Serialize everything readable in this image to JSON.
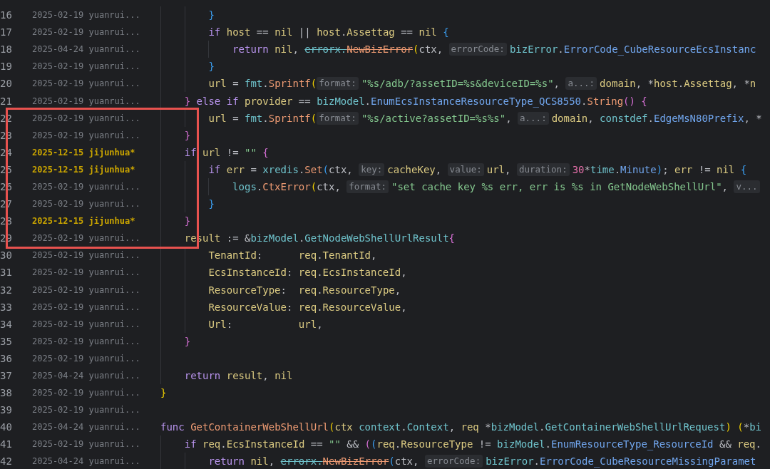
{
  "editor": {
    "lines": [
      {
        "kind": "block",
        "children": [
          {
            "kind": "block",
            "children": [
              {
                "kind": "line",
                "number": "16",
                "blame": {
                  "date": "2025-02-19",
                  "author": "yuanrui...",
                  "highlighted": false
                },
                "code": [
                  {
                    "kind": "bracket_3",
                    "text": "}"
                  }
                ]
              },
              {
                "kind": "line",
                "number": "17",
                "blame": {
                  "date": "2025-02-19",
                  "author": "yuanrui...",
                  "highlighted": false
                },
                "code": [
                  {
                    "kind": "keyword",
                    "text": "if "
                  },
                  {
                    "kind": "var",
                    "text": "host"
                  },
                  {
                    "kind": "plain",
                    "text": " == "
                  },
                  {
                    "kind": "var",
                    "text": "nil"
                  },
                  {
                    "kind": "plain",
                    "text": " || "
                  },
                  {
                    "kind": "var",
                    "text": "host"
                  },
                  {
                    "kind": "plain",
                    "text": "."
                  },
                  {
                    "kind": "field",
                    "text": "Assettag"
                  },
                  {
                    "kind": "plain",
                    "text": " == "
                  },
                  {
                    "kind": "var",
                    "text": "nil "
                  },
                  {
                    "kind": "bracket_3",
                    "text": "{"
                  }
                ]
              },
              {
                "kind": "block",
                "children": [
                  {
                    "kind": "line",
                    "number": "18",
                    "blame": {
                      "date": "2025-04-24",
                      "author": "yuanrui...",
                      "highlighted": false
                    },
                    "code": [
                      {
                        "kind": "keyword",
                        "text": "return "
                      },
                      {
                        "kind": "var",
                        "text": "nil"
                      },
                      {
                        "kind": "plain",
                        "text": ", "
                      },
                      {
                        "kind": "deprecated_pkg",
                        "text": "errorx."
                      },
                      {
                        "kind": "deprecated_func",
                        "text": "NewBizError"
                      },
                      {
                        "kind": "bracket_1",
                        "text": "("
                      },
                      {
                        "kind": "plain",
                        "text": "ctx, "
                      },
                      {
                        "kind": "hint",
                        "text": "errorCode:"
                      },
                      {
                        "kind": "pkg",
                        "text": "bizError"
                      },
                      {
                        "kind": "plain",
                        "text": "."
                      },
                      {
                        "kind": "const",
                        "text": "ErrorCode_CubeResourceEcsInstanc"
                      }
                    ]
                  }
                ]
              },
              {
                "kind": "line",
                "number": "19",
                "blame": {
                  "date": "2025-02-19",
                  "author": "yuanrui...",
                  "highlighted": false
                },
                "code": [
                  {
                    "kind": "bracket_3",
                    "text": "}"
                  }
                ]
              },
              {
                "kind": "line",
                "number": "20",
                "blame": {
                  "date": "2025-02-19",
                  "author": "yuanrui...",
                  "highlighted": false
                },
                "code": [
                  {
                    "kind": "var",
                    "text": "url"
                  },
                  {
                    "kind": "plain",
                    "text": " = "
                  },
                  {
                    "kind": "pkg",
                    "text": "fmt"
                  },
                  {
                    "kind": "plain",
                    "text": "."
                  },
                  {
                    "kind": "func",
                    "text": "Sprintf"
                  },
                  {
                    "kind": "bracket_1",
                    "text": "("
                  },
                  {
                    "kind": "hint",
                    "text": "format:"
                  },
                  {
                    "kind": "str",
                    "text": "\"%s/adb/?assetID=%s&deviceID=%s\""
                  },
                  {
                    "kind": "plain",
                    "text": ", "
                  },
                  {
                    "kind": "hint",
                    "text": "a...:"
                  },
                  {
                    "kind": "var",
                    "text": "domain"
                  },
                  {
                    "kind": "plain",
                    "text": ", *"
                  },
                  {
                    "kind": "var",
                    "text": "host"
                  },
                  {
                    "kind": "plain",
                    "text": "."
                  },
                  {
                    "kind": "field",
                    "text": "Assettag"
                  },
                  {
                    "kind": "plain",
                    "text": ", *"
                  },
                  {
                    "kind": "var",
                    "text": "n"
                  }
                ]
              }
            ]
          },
          {
            "kind": "line",
            "number": "21",
            "blame": {
              "date": "2025-02-19",
              "author": "yuanrui...",
              "highlighted": false
            },
            "code": [
              {
                "kind": "bracket_2",
                "text": "} "
              },
              {
                "kind": "keyword",
                "text": "else if "
              },
              {
                "kind": "var",
                "text": "provider"
              },
              {
                "kind": "plain",
                "text": " == "
              },
              {
                "kind": "pkg",
                "text": "bizModel"
              },
              {
                "kind": "plain",
                "text": "."
              },
              {
                "kind": "const",
                "text": "EnumEcsInstanceResourceType_QCS8550"
              },
              {
                "kind": "plain",
                "text": "."
              },
              {
                "kind": "func",
                "text": "String"
              },
              {
                "kind": "bracket_2",
                "text": "() {"
              }
            ]
          },
          {
            "kind": "block",
            "children": [
              {
                "kind": "line",
                "number": "22",
                "blame": {
                  "date": "2025-02-19",
                  "author": "yuanrui...",
                  "highlighted": false
                },
                "code": [
                  {
                    "kind": "var",
                    "text": "url"
                  },
                  {
                    "kind": "plain",
                    "text": " = "
                  },
                  {
                    "kind": "pkg",
                    "text": "fmt"
                  },
                  {
                    "kind": "plain",
                    "text": "."
                  },
                  {
                    "kind": "func",
                    "text": "Sprintf"
                  },
                  {
                    "kind": "bracket_1",
                    "text": "("
                  },
                  {
                    "kind": "hint",
                    "text": "format:"
                  },
                  {
                    "kind": "str",
                    "text": "\"%s/active?assetID=%s%s\""
                  },
                  {
                    "kind": "plain",
                    "text": ", "
                  },
                  {
                    "kind": "hint",
                    "text": "a...:"
                  },
                  {
                    "kind": "var",
                    "text": "domain"
                  },
                  {
                    "kind": "plain",
                    "text": ", "
                  },
                  {
                    "kind": "pkg",
                    "text": "constdef"
                  },
                  {
                    "kind": "plain",
                    "text": "."
                  },
                  {
                    "kind": "const",
                    "text": "EdgeMsN80Prefix"
                  },
                  {
                    "kind": "plain",
                    "text": ", *"
                  }
                ]
              }
            ]
          },
          {
            "kind": "line",
            "number": "23",
            "blame": {
              "date": "2025-02-19",
              "author": "yuanrui...",
              "highlighted": false
            },
            "code": [
              {
                "kind": "bracket_2",
                "text": "}"
              }
            ]
          },
          {
            "kind": "line",
            "number": "24",
            "blame": {
              "date": "2025-12-15",
              "author": "jijunhua*",
              "highlighted": true
            },
            "code": [
              {
                "kind": "keyword",
                "text": "if "
              },
              {
                "kind": "var",
                "text": "url"
              },
              {
                "kind": "plain",
                "text": " != "
              },
              {
                "kind": "str",
                "text": "\"\" "
              },
              {
                "kind": "bracket_2",
                "text": "{"
              }
            ]
          },
          {
            "kind": "block",
            "children": [
              {
                "kind": "line",
                "number": "25",
                "blame": {
                  "date": "2025-12-15",
                  "author": "jijunhua*",
                  "highlighted": true
                },
                "code": [
                  {
                    "kind": "keyword",
                    "text": "if "
                  },
                  {
                    "kind": "var",
                    "text": "err"
                  },
                  {
                    "kind": "plain",
                    "text": " = "
                  },
                  {
                    "kind": "pkg",
                    "text": "xredis"
                  },
                  {
                    "kind": "plain",
                    "text": "."
                  },
                  {
                    "kind": "func",
                    "text": "Set"
                  },
                  {
                    "kind": "bracket_3",
                    "text": "("
                  },
                  {
                    "kind": "plain",
                    "text": "ctx, "
                  },
                  {
                    "kind": "hint",
                    "text": "key:"
                  },
                  {
                    "kind": "var",
                    "text": "cacheKey"
                  },
                  {
                    "kind": "plain",
                    "text": ", "
                  },
                  {
                    "kind": "hint",
                    "text": "value:"
                  },
                  {
                    "kind": "var",
                    "text": "url"
                  },
                  {
                    "kind": "plain",
                    "text": ", "
                  },
                  {
                    "kind": "hint",
                    "text": "duration:"
                  },
                  {
                    "kind": "num",
                    "text": "30"
                  },
                  {
                    "kind": "plain",
                    "text": "*"
                  },
                  {
                    "kind": "pkg",
                    "text": "time"
                  },
                  {
                    "kind": "plain",
                    "text": "."
                  },
                  {
                    "kind": "const",
                    "text": "Minute"
                  },
                  {
                    "kind": "bracket_3",
                    "text": ")"
                  },
                  {
                    "kind": "plain",
                    "text": "; "
                  },
                  {
                    "kind": "var",
                    "text": "err"
                  },
                  {
                    "kind": "plain",
                    "text": " != "
                  },
                  {
                    "kind": "var",
                    "text": "nil "
                  },
                  {
                    "kind": "bracket_3",
                    "text": "{"
                  }
                ]
              },
              {
                "kind": "block",
                "children": [
                  {
                    "kind": "line",
                    "number": "26",
                    "blame": {
                      "date": "2025-02-19",
                      "author": "yuanrui...",
                      "highlighted": false
                    },
                    "code": [
                      {
                        "kind": "pkg",
                        "text": "logs"
                      },
                      {
                        "kind": "plain",
                        "text": "."
                      },
                      {
                        "kind": "func",
                        "text": "CtxError"
                      },
                      {
                        "kind": "bracket_1",
                        "text": "("
                      },
                      {
                        "kind": "plain",
                        "text": "ctx, "
                      },
                      {
                        "kind": "hint",
                        "text": "format:"
                      },
                      {
                        "kind": "str",
                        "text": "\"set cache key %s err, err is %s in GetNodeWebShellUrl\""
                      },
                      {
                        "kind": "plain",
                        "text": ", "
                      },
                      {
                        "kind": "hint",
                        "text": "v..."
                      }
                    ]
                  }
                ]
              },
              {
                "kind": "line",
                "number": "27",
                "blame": {
                  "date": "2025-02-19",
                  "author": "yuanrui...",
                  "highlighted": false
                },
                "code": [
                  {
                    "kind": "bracket_3",
                    "text": "}"
                  }
                ]
              }
            ]
          },
          {
            "kind": "line",
            "number": "28",
            "blame": {
              "date": "2025-12-15",
              "author": "jijunhua*",
              "highlighted": true
            },
            "code": [
              {
                "kind": "bracket_2",
                "text": "}"
              }
            ]
          },
          {
            "kind": "line",
            "number": "29",
            "blame": {
              "date": "2025-02-19",
              "author": "yuanrui...",
              "highlighted": false
            },
            "code": [
              {
                "kind": "var",
                "text": "result"
              },
              {
                "kind": "plain",
                "text": " := &"
              },
              {
                "kind": "pkg",
                "text": "bizModel"
              },
              {
                "kind": "plain",
                "text": "."
              },
              {
                "kind": "type",
                "text": "GetNodeWebShellUrlResult"
              },
              {
                "kind": "bracket_2",
                "text": "{"
              }
            ]
          },
          {
            "kind": "block",
            "children": [
              {
                "kind": "line",
                "number": "30",
                "blame": {
                  "date": "2025-02-19",
                  "author": "yuanrui...",
                  "highlighted": false
                },
                "code": [
                  {
                    "kind": "field",
                    "text": "TenantId"
                  },
                  {
                    "kind": "plain",
                    "text": ":      "
                  },
                  {
                    "kind": "var",
                    "text": "req"
                  },
                  {
                    "kind": "plain",
                    "text": "."
                  },
                  {
                    "kind": "field",
                    "text": "TenantId"
                  },
                  {
                    "kind": "plain",
                    "text": ","
                  }
                ]
              },
              {
                "kind": "line",
                "number": "31",
                "blame": {
                  "date": "2025-02-19",
                  "author": "yuanrui...",
                  "highlighted": false
                },
                "code": [
                  {
                    "kind": "field",
                    "text": "EcsInstanceId"
                  },
                  {
                    "kind": "plain",
                    "text": ": "
                  },
                  {
                    "kind": "var",
                    "text": "req"
                  },
                  {
                    "kind": "plain",
                    "text": "."
                  },
                  {
                    "kind": "field",
                    "text": "EcsInstanceId"
                  },
                  {
                    "kind": "plain",
                    "text": ","
                  }
                ]
              },
              {
                "kind": "line",
                "number": "32",
                "blame": {
                  "date": "2025-02-19",
                  "author": "yuanrui...",
                  "highlighted": false
                },
                "code": [
                  {
                    "kind": "field",
                    "text": "ResourceType"
                  },
                  {
                    "kind": "plain",
                    "text": ":  "
                  },
                  {
                    "kind": "var",
                    "text": "req"
                  },
                  {
                    "kind": "plain",
                    "text": "."
                  },
                  {
                    "kind": "field",
                    "text": "ResourceType"
                  },
                  {
                    "kind": "plain",
                    "text": ","
                  }
                ]
              },
              {
                "kind": "line",
                "number": "33",
                "blame": {
                  "date": "2025-02-19",
                  "author": "yuanrui...",
                  "highlighted": false
                },
                "code": [
                  {
                    "kind": "field",
                    "text": "ResourceValue"
                  },
                  {
                    "kind": "plain",
                    "text": ": "
                  },
                  {
                    "kind": "var",
                    "text": "req"
                  },
                  {
                    "kind": "plain",
                    "text": "."
                  },
                  {
                    "kind": "field",
                    "text": "ResourceValue"
                  },
                  {
                    "kind": "plain",
                    "text": ","
                  }
                ]
              },
              {
                "kind": "line",
                "number": "34",
                "blame": {
                  "date": "2025-02-19",
                  "author": "yuanrui...",
                  "highlighted": false
                },
                "code": [
                  {
                    "kind": "field",
                    "text": "Url"
                  },
                  {
                    "kind": "plain",
                    "text": ":           "
                  },
                  {
                    "kind": "var",
                    "text": "url"
                  },
                  {
                    "kind": "plain",
                    "text": ","
                  }
                ]
              }
            ]
          },
          {
            "kind": "line",
            "number": "35",
            "blame": {
              "date": "2025-02-19",
              "author": "yuanrui...",
              "highlighted": false
            },
            "code": [
              {
                "kind": "bracket_2",
                "text": "}"
              }
            ]
          },
          {
            "kind": "line",
            "number": "36",
            "blame": {
              "date": "2025-02-19",
              "author": "yuanrui...",
              "highlighted": false
            }
          },
          {
            "kind": "line",
            "number": "37",
            "blame": {
              "date": "2025-04-24",
              "author": "yuanrui...",
              "highlighted": false
            },
            "code": [
              {
                "kind": "keyword",
                "text": "return "
              },
              {
                "kind": "var",
                "text": "result"
              },
              {
                "kind": "plain",
                "text": ", "
              },
              {
                "kind": "var",
                "text": "nil"
              }
            ]
          }
        ]
      },
      {
        "kind": "line",
        "number": "38",
        "blame": {
          "date": "2025-02-19",
          "author": "yuanrui...",
          "highlighted": false
        },
        "code": [
          {
            "kind": "bracket_1",
            "text": "}"
          }
        ]
      },
      {
        "kind": "line",
        "number": "39",
        "blame": {
          "date": "2025-02-19",
          "author": "yuanrui...",
          "highlighted": false
        }
      },
      {
        "kind": "line",
        "number": "40",
        "blame": {
          "date": "2025-04-24",
          "author": "yuanrui...",
          "highlighted": false
        },
        "code": [
          {
            "kind": "keyword",
            "text": "func "
          },
          {
            "kind": "func",
            "text": "GetContainerWebShellUrl"
          },
          {
            "kind": "bracket_1",
            "text": "("
          },
          {
            "kind": "var",
            "text": "ctx "
          },
          {
            "kind": "pkg",
            "text": "context"
          },
          {
            "kind": "plain",
            "text": "."
          },
          {
            "kind": "type",
            "text": "Context"
          },
          {
            "kind": "plain",
            "text": ", "
          },
          {
            "kind": "var",
            "text": "req"
          },
          {
            "kind": "plain",
            "text": " *"
          },
          {
            "kind": "pkg",
            "text": "bizModel"
          },
          {
            "kind": "plain",
            "text": "."
          },
          {
            "kind": "type",
            "text": "GetContainerWebShellUrlRequest"
          },
          {
            "kind": "bracket_1",
            "text": ") ("
          },
          {
            "kind": "plain",
            "text": "*"
          },
          {
            "kind": "pkg",
            "text": "bi"
          }
        ]
      },
      {
        "kind": "block",
        "children": [
          {
            "kind": "line",
            "number": "41",
            "blame": {
              "date": "2025-02-19",
              "author": "yuanrui...",
              "highlighted": false
            },
            "code": [
              {
                "kind": "keyword",
                "text": "if "
              },
              {
                "kind": "var",
                "text": "req"
              },
              {
                "kind": "plain",
                "text": "."
              },
              {
                "kind": "field",
                "text": "EcsInstanceId"
              },
              {
                "kind": "plain",
                "text": " == "
              },
              {
                "kind": "str",
                "text": "\"\""
              },
              {
                "kind": "plain",
                "text": " && "
              },
              {
                "kind": "bracket_2",
                "text": "("
              },
              {
                "kind": "bracket_3",
                "text": "("
              },
              {
                "kind": "var",
                "text": "req"
              },
              {
                "kind": "plain",
                "text": "."
              },
              {
                "kind": "field",
                "text": "ResourceType"
              },
              {
                "kind": "plain",
                "text": " != "
              },
              {
                "kind": "pkg",
                "text": "bizModel"
              },
              {
                "kind": "plain",
                "text": "."
              },
              {
                "kind": "const",
                "text": "EnumResourceType_ResourceId"
              },
              {
                "kind": "plain",
                "text": " && "
              },
              {
                "kind": "var",
                "text": "req"
              },
              {
                "kind": "plain",
                "text": "."
              }
            ]
          },
          {
            "kind": "block",
            "children": [
              {
                "kind": "line",
                "number": "42",
                "blame": {
                  "date": "2025-04-24",
                  "author": "yuanrui...",
                  "highlighted": false
                },
                "code": [
                  {
                    "kind": "keyword",
                    "text": "return "
                  },
                  {
                    "kind": "var",
                    "text": "nil"
                  },
                  {
                    "kind": "plain",
                    "text": ", "
                  },
                  {
                    "kind": "deprecated_pkg",
                    "text": "errorx."
                  },
                  {
                    "kind": "deprecated_func",
                    "text": "NewBizError"
                  },
                  {
                    "kind": "bracket_3",
                    "text": "("
                  },
                  {
                    "kind": "plain",
                    "text": "ctx, "
                  },
                  {
                    "kind": "hint",
                    "text": "errorCode:"
                  },
                  {
                    "kind": "pkg",
                    "text": "bizError"
                  },
                  {
                    "kind": "plain",
                    "text": "."
                  },
                  {
                    "kind": "const",
                    "text": "ErrorCode_CubeResourceMissingParamet"
                  }
                ]
              }
            ]
          }
        ]
      }
    ]
  }
}
